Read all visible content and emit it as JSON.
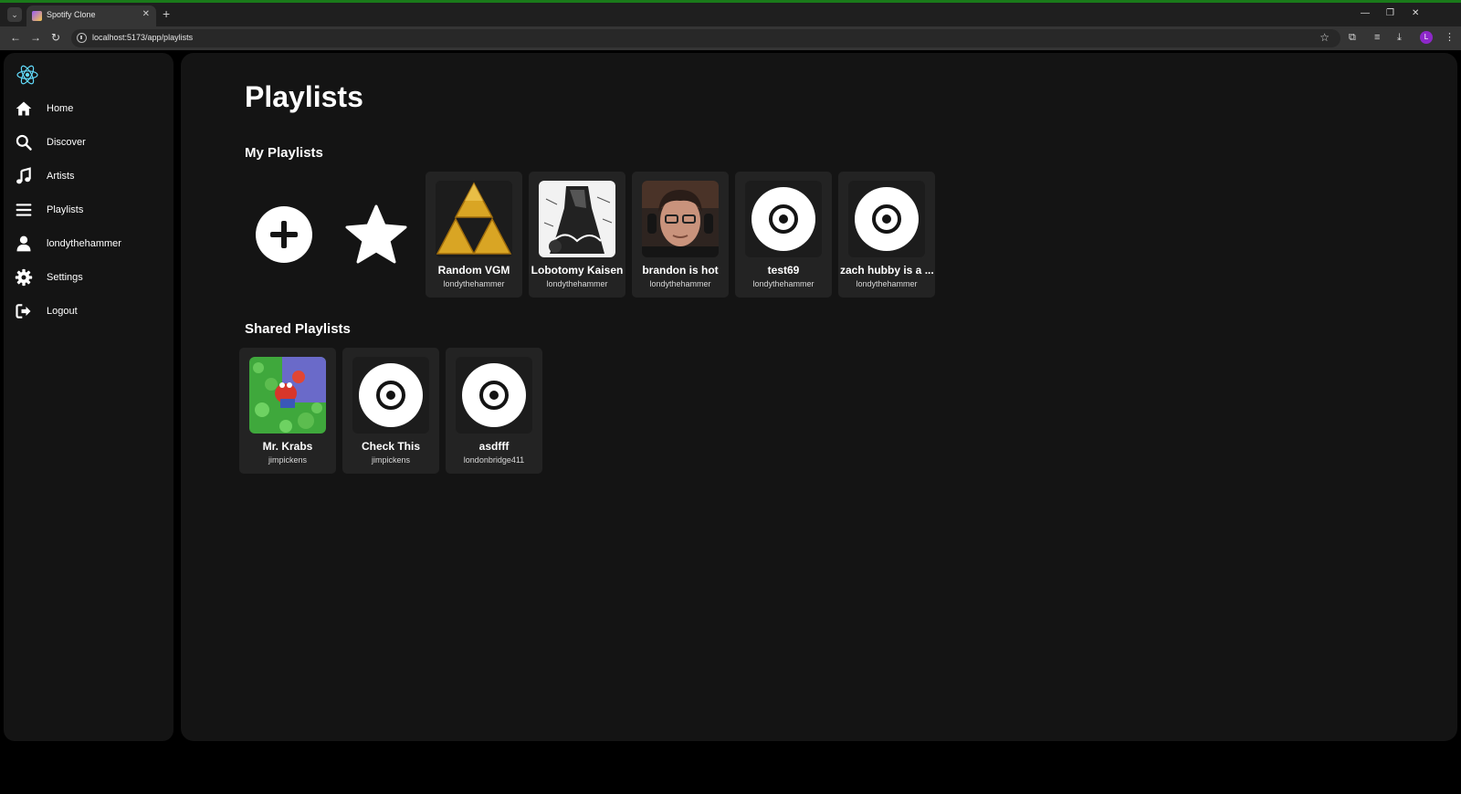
{
  "browser": {
    "tab_title": "Spotify Clone",
    "url": "localhost:5173/app/playlists",
    "profile_initial": "L"
  },
  "sidebar": {
    "items": [
      {
        "label": "Home",
        "icon": "home-icon"
      },
      {
        "label": "Discover",
        "icon": "search-icon"
      },
      {
        "label": "Artists",
        "icon": "music-note-icon"
      },
      {
        "label": "Playlists",
        "icon": "list-icon"
      },
      {
        "label": "londythehammer",
        "icon": "user-icon"
      },
      {
        "label": "Settings",
        "icon": "gear-icon"
      },
      {
        "label": "Logout",
        "icon": "logout-icon"
      }
    ]
  },
  "main": {
    "title": "Playlists",
    "my_playlists_heading": "My Playlists",
    "shared_playlists_heading": "Shared Playlists",
    "my_playlists": [
      {
        "name": "Random VGM",
        "owner": "londythehammer",
        "cover": "triforce"
      },
      {
        "name": "Lobotomy Kaisen",
        "owner": "londythehammer",
        "cover": "sketch"
      },
      {
        "name": "brandon is hot",
        "owner": "londythehammer",
        "cover": "photo"
      },
      {
        "name": "test69",
        "owner": "londythehammer",
        "cover": "default-disc"
      },
      {
        "name": "zach hubby is a ...",
        "owner": "londythehammer",
        "cover": "default-disc"
      }
    ],
    "shared_playlists": [
      {
        "name": "Mr. Krabs",
        "owner": "jimpickens",
        "cover": "krabs"
      },
      {
        "name": "Check This",
        "owner": "jimpickens",
        "cover": "default-disc"
      },
      {
        "name": "asdfff",
        "owner": "londonbridge411",
        "cover": "default-disc"
      }
    ]
  },
  "colors": {
    "background": "#000000",
    "panel": "#141414",
    "card": "#232323",
    "accent_logo": "#61dafb"
  }
}
